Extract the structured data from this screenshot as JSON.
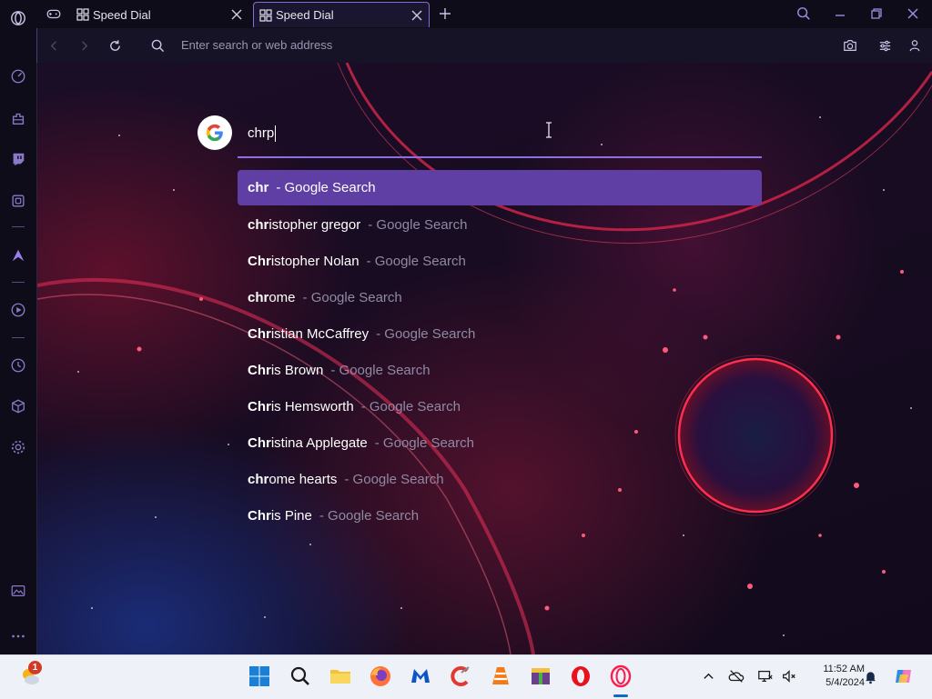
{
  "tabs": [
    {
      "label": "Speed Dial",
      "active": false
    },
    {
      "label": "Speed Dial",
      "active": true
    }
  ],
  "address_bar": {
    "placeholder": "Enter search or web address"
  },
  "search": {
    "query": "chrp",
    "engine_icon": "google-g-icon"
  },
  "suggestions": [
    {
      "bold": "chr",
      "rest": "",
      "source": "- Google Search",
      "selected": true
    },
    {
      "bold": "chr",
      "rest": "istopher gregor",
      "source": "- Google Search",
      "selected": false
    },
    {
      "bold": "Chr",
      "rest": "istopher Nolan",
      "source": "- Google Search",
      "selected": false
    },
    {
      "bold": "chr",
      "rest": "ome",
      "source": "- Google Search",
      "selected": false
    },
    {
      "bold": "Chr",
      "rest": "istian McCaffrey",
      "source": "- Google Search",
      "selected": false
    },
    {
      "bold": "Chr",
      "rest": "is Brown",
      "source": "- Google Search",
      "selected": false
    },
    {
      "bold": "Chr",
      "rest": "is Hemsworth",
      "source": "- Google Search",
      "selected": false
    },
    {
      "bold": "Chr",
      "rest": "istina Applegate",
      "source": "- Google Search",
      "selected": false
    },
    {
      "bold": "chr",
      "rest": "ome hearts",
      "source": "- Google Search",
      "selected": false
    },
    {
      "bold": "Chr",
      "rest": "is Pine",
      "source": "- Google Search",
      "selected": false
    }
  ],
  "sidebar_icons": [
    "opera-logo-icon",
    "speed-dial-icon",
    "extensions-icon",
    "twitch-icon",
    "cube-icon",
    "aria-icon",
    "player-icon",
    "history-icon",
    "box-icon",
    "settings-icon",
    "wallpaper-icon",
    "more-icon"
  ],
  "taskbar": {
    "weather_badge": "1",
    "clock_time": "11:52 AM",
    "clock_date": "5/4/2024",
    "apps": [
      "start-icon",
      "search-icon",
      "file-explorer-icon",
      "firefox-icon",
      "malwarebytes-icon",
      "ccleaner-icon",
      "vlc-icon",
      "archive-icon",
      "opera-icon",
      "opera-gx-icon"
    ]
  },
  "colors": {
    "accent": "#8d6fe0",
    "selected_row": "#5f3fa3",
    "sidebar_bg": "#0e0c18"
  }
}
